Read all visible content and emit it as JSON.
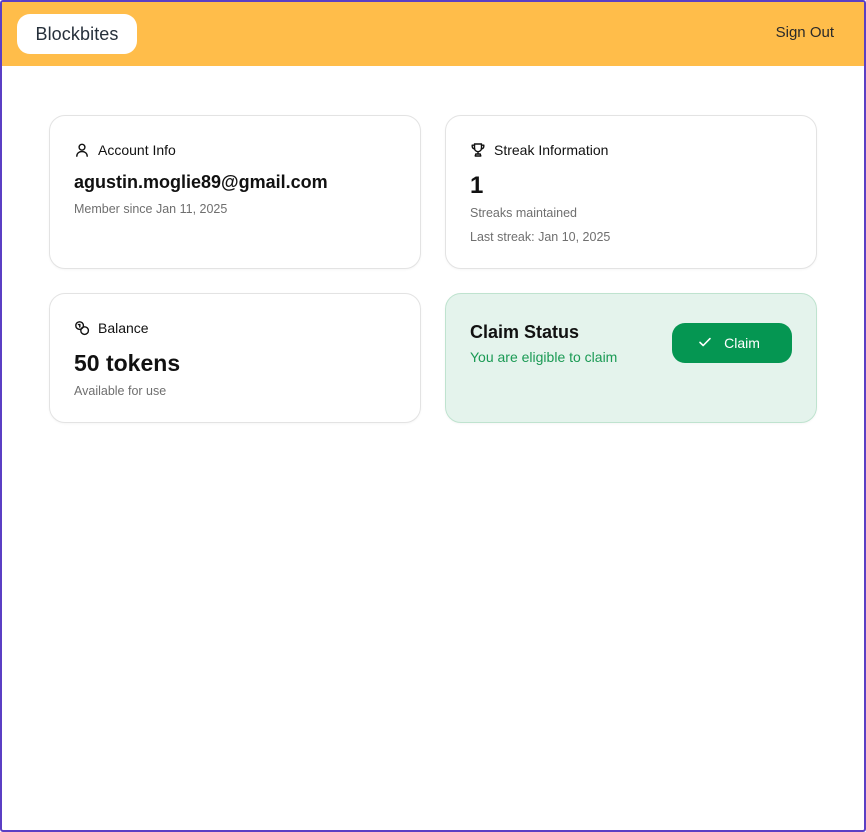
{
  "header": {
    "brand": "Blockbites",
    "sign_out_label": "Sign Out",
    "background_color": "#ffbd4a"
  },
  "account": {
    "icon": "user-icon",
    "title": "Account Info",
    "email": "agustin.moglie89@gmail.com",
    "member_since": "Member since Jan 11, 2025"
  },
  "streak": {
    "icon": "trophy-icon",
    "title": "Streak Information",
    "count": "1",
    "count_label": "Streaks maintained",
    "last_streak": "Last streak: Jan 10, 2025"
  },
  "balance": {
    "icon": "coins-icon",
    "title": "Balance",
    "amount": "50 tokens",
    "caption": "Available for use"
  },
  "claim": {
    "title": "Claim Status",
    "status_text": "You are eligible to claim",
    "button_label": "Claim",
    "button_icon": "check-icon",
    "accent_color": "#059652",
    "card_background": "#e4f3ec"
  }
}
